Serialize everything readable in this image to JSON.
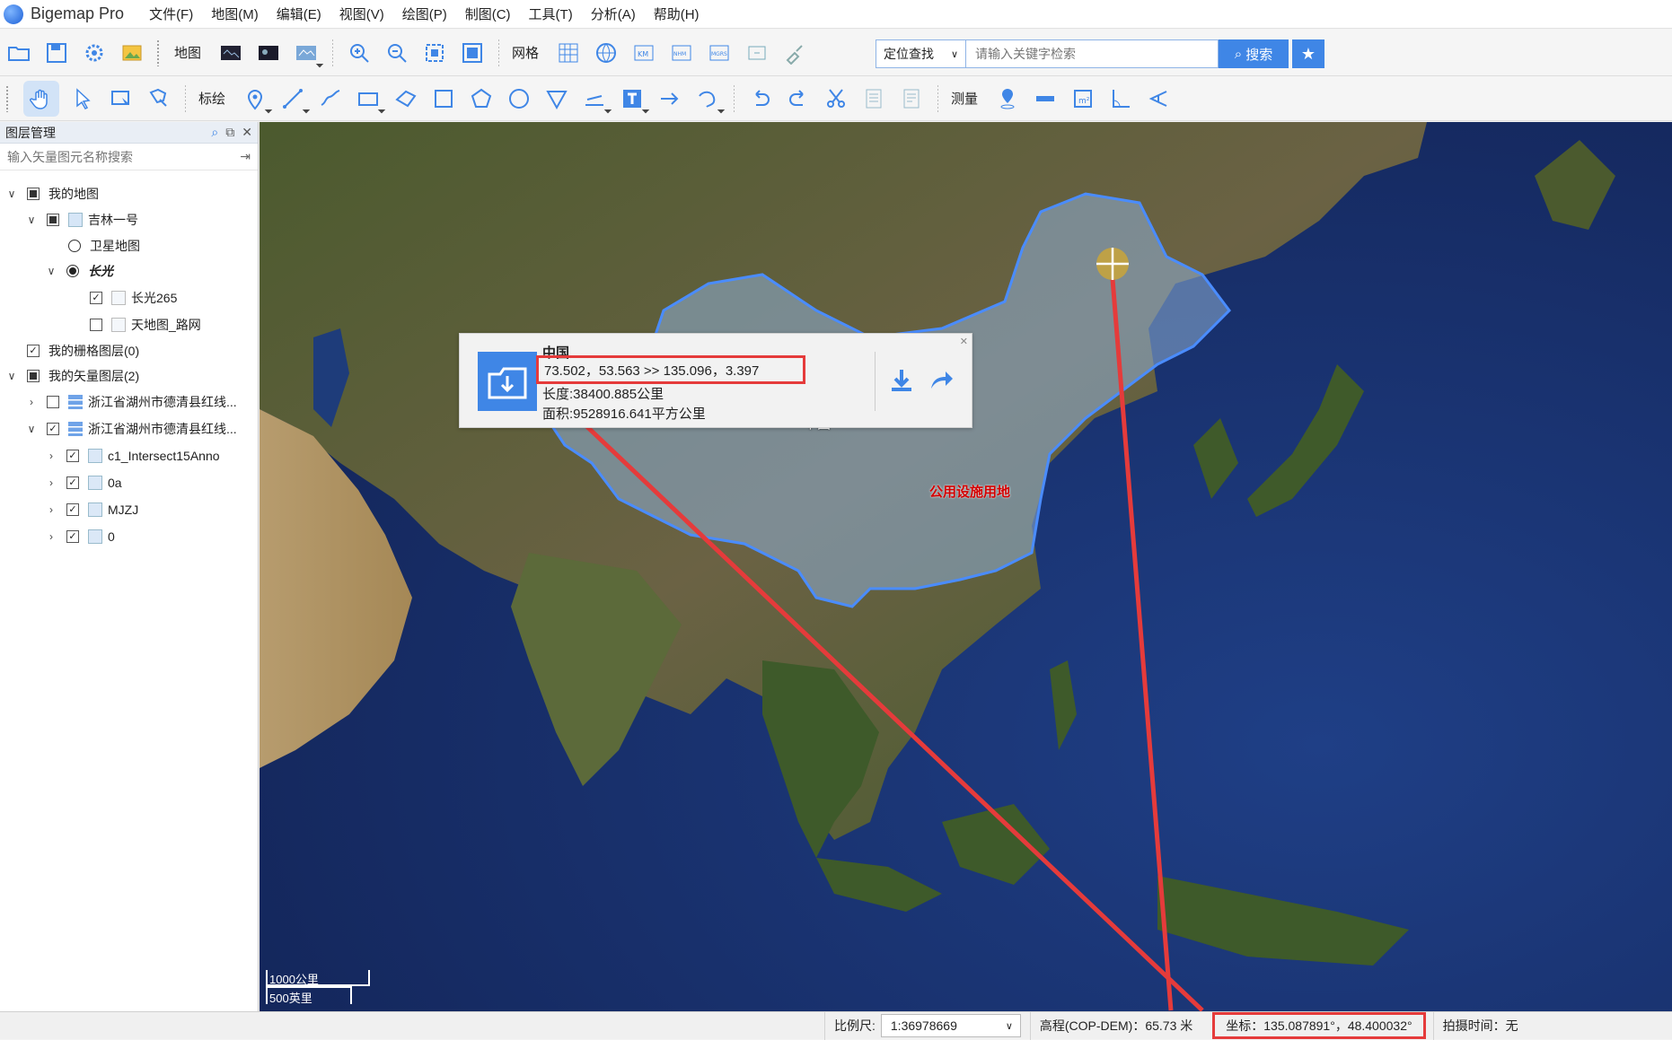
{
  "app": {
    "title": "Bigemap Pro"
  },
  "menu": [
    "文件(F)",
    "地图(M)",
    "编辑(E)",
    "视图(V)",
    "绘图(P)",
    "制图(C)",
    "工具(T)",
    "分析(A)",
    "帮助(H)"
  ],
  "toolbar1": {
    "map_label": "地图",
    "grid_label": "网格",
    "locate_select": "定位查找",
    "search_placeholder": "请输入关键字检索",
    "search_button": "搜索"
  },
  "toolbar2": {
    "mark_label": "标绘",
    "measure_label": "测量"
  },
  "layer_panel": {
    "title": "图层管理",
    "search_placeholder": "输入矢量图元名称搜索",
    "items": [
      {
        "label": "我的地图"
      },
      {
        "label": "吉林一号"
      },
      {
        "label": "卫星地图"
      },
      {
        "label": "长光"
      },
      {
        "label": "长光265"
      },
      {
        "label": "天地图_路网"
      },
      {
        "label": "我的栅格图层(0)"
      },
      {
        "label": "我的矢量图层(2)"
      },
      {
        "label": "浙江省湖州市德清县红线..."
      },
      {
        "label": "浙江省湖州市德清县红线..."
      },
      {
        "label": "c1_Intersect15Anno"
      },
      {
        "label": "0a"
      },
      {
        "label": "MJZJ"
      },
      {
        "label": "0"
      }
    ]
  },
  "popup": {
    "title": "中国",
    "coords": "73.502，53.563 >> 135.096，3.397",
    "length": "长度:38400.885公里",
    "area": "面积:9528916.641平方公里"
  },
  "map": {
    "label_china": "中国",
    "label_facility": "公用设施用地",
    "scale_km": "1000公里",
    "scale_mi": "500英里"
  },
  "status": {
    "scale_label": "比例尺:",
    "scale_value": "1:36978669",
    "elevation": "高程(COP-DEM)：65.73 米",
    "coord": "坐标：135.087891°，48.400032°",
    "capture_time": "拍摄时间：无"
  },
  "colors": {
    "accent": "#3f86e6",
    "highlight_red": "#e53b3b",
    "boundary_blue": "#4a8cff"
  }
}
